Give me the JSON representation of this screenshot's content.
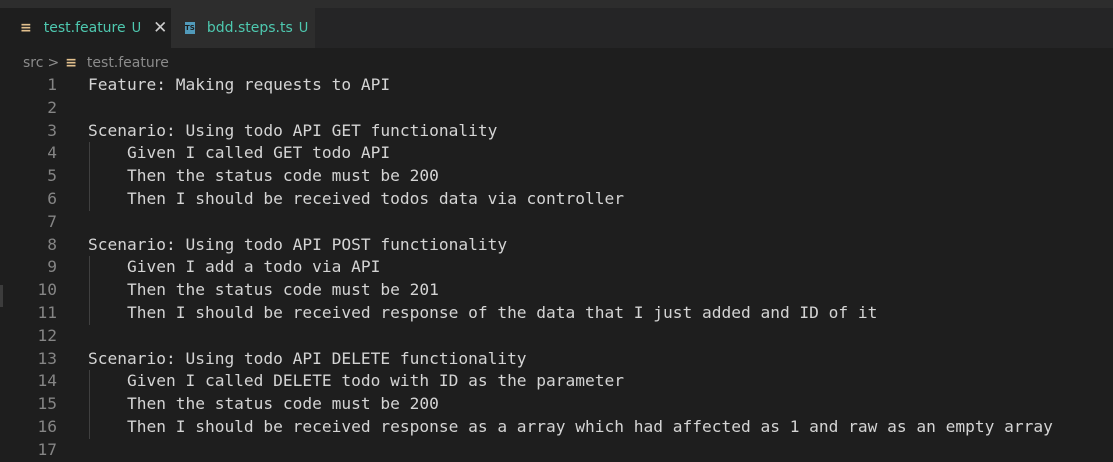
{
  "tabs": [
    {
      "label": "test.feature",
      "status": "U",
      "icon": "feature-file-icon",
      "active": true
    },
    {
      "label": "bdd.steps.ts",
      "status": "U",
      "icon": "typescript-file-icon",
      "active": false
    }
  ],
  "close_glyph": "✕",
  "breadcrumb": {
    "folder": "src",
    "separator": ">",
    "file": "test.feature"
  },
  "lines": [
    {
      "n": "1",
      "text": "Feature: Making requests to API"
    },
    {
      "n": "2",
      "text": ""
    },
    {
      "n": "3",
      "text": "Scenario: Using todo API GET functionality"
    },
    {
      "n": "4",
      "text": "    Given I called GET todo API"
    },
    {
      "n": "5",
      "text": "    Then the status code must be 200"
    },
    {
      "n": "6",
      "text": "    Then I should be received todos data via controller"
    },
    {
      "n": "7",
      "text": ""
    },
    {
      "n": "8",
      "text": "Scenario: Using todo API POST functionality"
    },
    {
      "n": "9",
      "text": "    Given I add a todo via API"
    },
    {
      "n": "10",
      "text": "    Then the status code must be 201"
    },
    {
      "n": "11",
      "text": "    Then I should be received response of the data that I just added and ID of it"
    },
    {
      "n": "12",
      "text": ""
    },
    {
      "n": "13",
      "text": "Scenario: Using todo API DELETE functionality"
    },
    {
      "n": "14",
      "text": "    Given I called DELETE todo with ID as the parameter"
    },
    {
      "n": "15",
      "text": "    Then the status code must be 200"
    },
    {
      "n": "16",
      "text": "    Then I should be received response as a array which had affected as 1 and raw as an empty array"
    },
    {
      "n": "17",
      "text": ""
    }
  ],
  "colors": {
    "accent": "#4ec9b0",
    "background": "#1e1e1e",
    "text": "#d4d4d4",
    "line_number": "#858585"
  }
}
